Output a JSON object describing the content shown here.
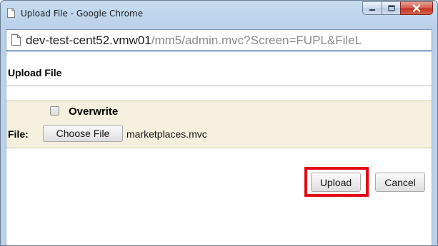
{
  "window": {
    "title": "Upload File - Google Chrome",
    "controls": [
      "minimize-icon",
      "maximize-icon",
      "close-icon"
    ]
  },
  "address_bar": {
    "host": "dev-test-cent52.vmw01",
    "path": "/mm5/admin.mvc?Screen=FUPL&FileL",
    "icon": "page-icon"
  },
  "page": {
    "heading": "Upload File",
    "overwrite": {
      "label": "Overwrite",
      "checked": false
    },
    "file": {
      "label": "File:",
      "choose_label": "Choose File",
      "selected_name": "marketplaces.mvc"
    },
    "actions": {
      "upload_label": "Upload",
      "cancel_label": "Cancel"
    }
  },
  "colors": {
    "highlight": "#e30613",
    "panel_background": "#f5f0dd",
    "chrome_frame": "#b9d1ea"
  }
}
